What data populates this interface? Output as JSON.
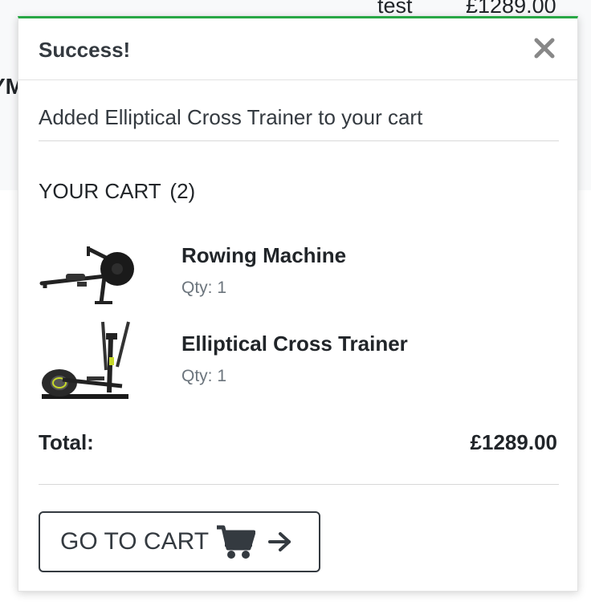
{
  "background": {
    "user_label": "test",
    "cart_total": "£1289.00",
    "brand_fragment": "YM"
  },
  "toast": {
    "title": "Success!",
    "close_icon": "close-icon",
    "message": "Added Elliptical Cross Trainer to your cart",
    "accent_color": "#28a745"
  },
  "cart": {
    "heading": "YOUR CART",
    "count": "(2)",
    "items": [
      {
        "name": "Rowing Machine",
        "qty": "Qty: 1",
        "icon": "rowing-machine-image"
      },
      {
        "name": "Elliptical Cross Trainer",
        "qty": "Qty: 1",
        "icon": "elliptical-trainer-image"
      }
    ],
    "total_label": "Total:",
    "total_value": "£1289.00"
  },
  "button": {
    "label": "GO TO CART",
    "icons": [
      "shopping-cart-icon",
      "arrow-right-icon"
    ]
  }
}
